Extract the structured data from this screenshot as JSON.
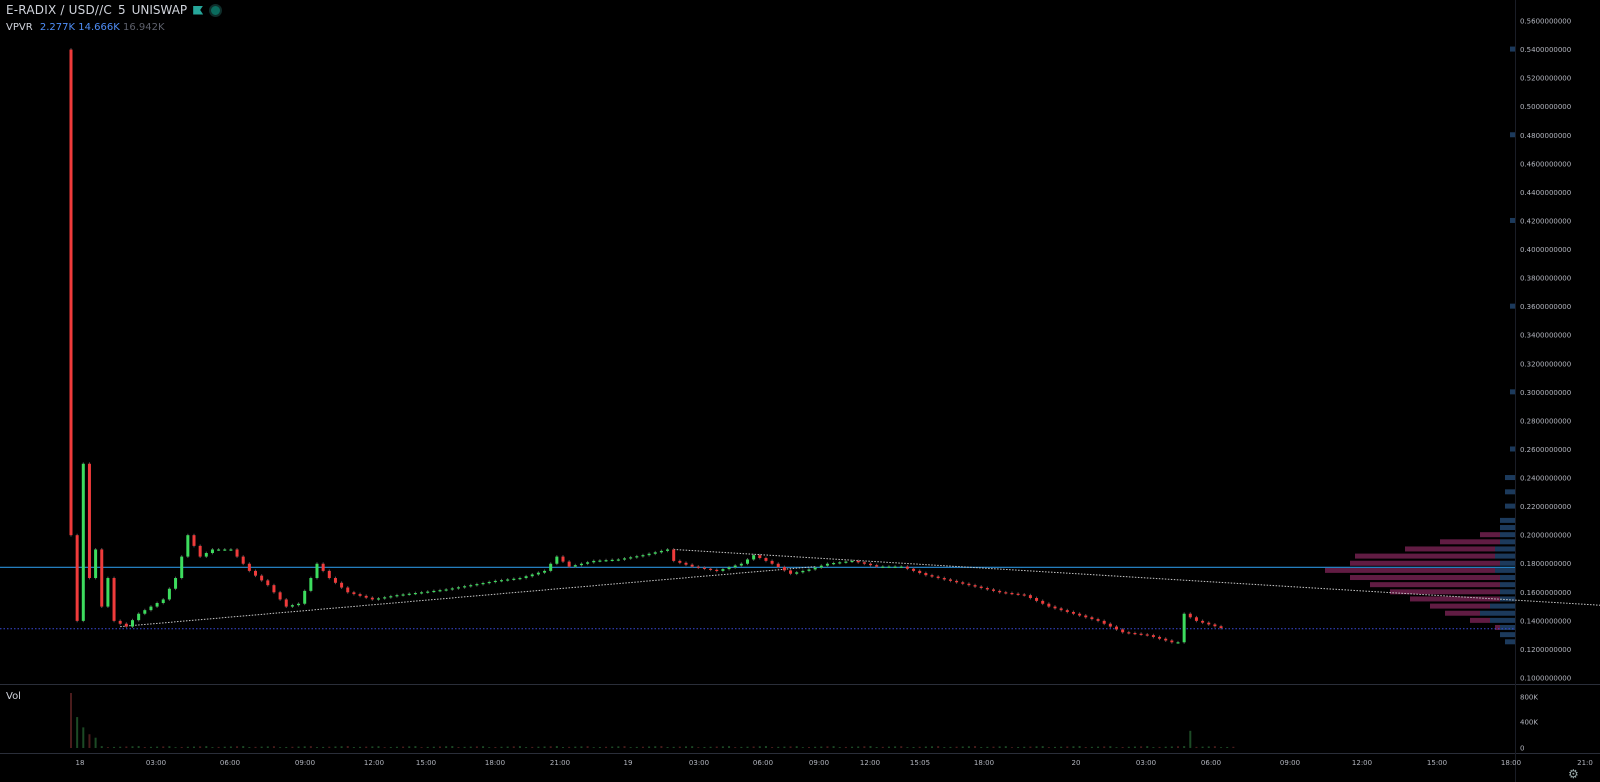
{
  "header": {
    "symbol": "E-RADIX / USD//C",
    "interval": "5",
    "exchange": "UNISWAP"
  },
  "indicator": {
    "name": "VPVR",
    "up_volume": "2.277K",
    "down_volume": "14.666K",
    "total_volume": "16.942K"
  },
  "volume_pane": {
    "label": "Vol",
    "axis_labels": [
      "800K",
      "400K",
      "0"
    ]
  },
  "colors": {
    "background": "#000000",
    "up": "#3ddc5e",
    "down": "#ef3b3b",
    "vp_up": "#1c3a5c",
    "vp_value_area": "#6b1f4a",
    "hline_solid": "#2a8fd8",
    "hline_dotted": "#3a4bd6"
  },
  "chart_data": {
    "type": "candlestick",
    "ylim": [
      0.1,
      0.56
    ],
    "y_tick_labels": [
      "0.5600000000",
      "0.5400000000",
      "0.5200000000",
      "0.5000000000",
      "0.4800000000",
      "0.4600000000",
      "0.4400000000",
      "0.4200000000",
      "0.4000000000",
      "0.3800000000",
      "0.3600000000",
      "0.3400000000",
      "0.3200000000",
      "0.3000000000",
      "0.2800000000",
      "0.2600000000",
      "0.2400000000",
      "0.2200000000",
      "0.2000000000",
      "0.1800000000",
      "0.1600000000",
      "0.1400000000",
      "0.1200000000",
      "0.1000000000"
    ],
    "x_tick_labels": [
      "18",
      "03:00",
      "06:00",
      "09:00",
      "12:00",
      "15:00",
      "18:00",
      "21:00",
      "19",
      "03:00",
      "06:00",
      "09:00",
      "12:00",
      "15:05",
      "18:00",
      "20",
      "03:00",
      "06:00",
      "09:00",
      "12:00",
      "15:00",
      "18:00",
      "21:0"
    ],
    "price_path": [
      [
        0,
        0.54
      ],
      [
        1,
        0.2
      ],
      [
        2,
        0.14
      ],
      [
        3,
        0.25
      ],
      [
        4,
        0.17
      ],
      [
        5,
        0.19
      ],
      [
        6,
        0.15
      ],
      [
        7,
        0.17
      ],
      [
        8,
        0.14
      ],
      [
        10,
        0.136
      ],
      [
        12,
        0.145
      ],
      [
        16,
        0.155
      ],
      [
        18,
        0.17
      ],
      [
        20,
        0.2
      ],
      [
        22,
        0.185
      ],
      [
        24,
        0.19
      ],
      [
        27,
        0.19
      ],
      [
        30,
        0.175
      ],
      [
        33,
        0.165
      ],
      [
        36,
        0.15
      ],
      [
        38,
        0.152
      ],
      [
        40,
        0.17
      ],
      [
        41,
        0.18
      ],
      [
        43,
        0.17
      ],
      [
        46,
        0.16
      ],
      [
        50,
        0.155
      ],
      [
        54,
        0.158
      ],
      [
        58,
        0.16
      ],
      [
        62,
        0.162
      ],
      [
        66,
        0.165
      ],
      [
        70,
        0.168
      ],
      [
        74,
        0.17
      ],
      [
        78,
        0.175
      ],
      [
        80,
        0.185
      ],
      [
        82,
        0.178
      ],
      [
        86,
        0.182
      ],
      [
        90,
        0.183
      ],
      [
        94,
        0.186
      ],
      [
        98,
        0.19
      ],
      [
        99,
        0.182
      ],
      [
        102,
        0.178
      ],
      [
        106,
        0.175
      ],
      [
        110,
        0.18
      ],
      [
        112,
        0.186
      ],
      [
        115,
        0.18
      ],
      [
        118,
        0.173
      ],
      [
        121,
        0.176
      ],
      [
        124,
        0.18
      ],
      [
        128,
        0.182
      ],
      [
        132,
        0.178
      ],
      [
        136,
        0.178
      ],
      [
        140,
        0.172
      ],
      [
        144,
        0.168
      ],
      [
        148,
        0.164
      ],
      [
        152,
        0.16
      ],
      [
        156,
        0.158
      ],
      [
        160,
        0.15
      ],
      [
        164,
        0.145
      ],
      [
        168,
        0.14
      ],
      [
        172,
        0.132
      ],
      [
        176,
        0.13
      ],
      [
        180,
        0.125
      ],
      [
        181,
        0.125
      ],
      [
        182,
        0.145
      ],
      [
        184,
        0.14
      ],
      [
        188,
        0.135
      ]
    ],
    "volume_spikes": [
      [
        0,
        800
      ],
      [
        1,
        450
      ],
      [
        2,
        300
      ],
      [
        3,
        200
      ],
      [
        4,
        150
      ],
      [
        182,
        250
      ]
    ],
    "horizontal_lines": [
      {
        "price": 0.1775,
        "style": "solid"
      },
      {
        "price": 0.1345,
        "style": "dotted"
      }
    ],
    "trend_lines": [
      {
        "from": [
          8,
          0.136
        ],
        "to": [
          121,
          0.178
        ]
      },
      {
        "from": [
          98,
          0.19
        ],
        "to": [
          260,
          0.148
        ]
      }
    ],
    "volume_profile": [
      {
        "price": 0.125,
        "up": 2,
        "down": 0
      },
      {
        "price": 0.13,
        "up": 3,
        "down": 0
      },
      {
        "price": 0.135,
        "up": 3,
        "down": 1
      },
      {
        "price": 0.14,
        "up": 5,
        "down": 4
      },
      {
        "price": 0.145,
        "up": 7,
        "down": 7
      },
      {
        "price": 0.15,
        "up": 5,
        "down": 12
      },
      {
        "price": 0.155,
        "up": 3,
        "down": 18
      },
      {
        "price": 0.16,
        "up": 3,
        "down": 22
      },
      {
        "price": 0.165,
        "up": 3,
        "down": 26
      },
      {
        "price": 0.17,
        "up": 3,
        "down": 30
      },
      {
        "price": 0.175,
        "up": 4,
        "down": 34
      },
      {
        "price": 0.18,
        "up": 3,
        "down": 30
      },
      {
        "price": 0.185,
        "up": 4,
        "down": 28
      },
      {
        "price": 0.19,
        "up": 4,
        "down": 18
      },
      {
        "price": 0.195,
        "up": 3,
        "down": 12
      },
      {
        "price": 0.2,
        "up": 3,
        "down": 4
      },
      {
        "price": 0.205,
        "up": 3,
        "down": 0
      },
      {
        "price": 0.21,
        "up": 3,
        "down": 0
      },
      {
        "price": 0.22,
        "up": 2,
        "down": 0
      },
      {
        "price": 0.23,
        "up": 2,
        "down": 0
      },
      {
        "price": 0.24,
        "up": 2,
        "down": 0
      },
      {
        "price": 0.26,
        "up": 1,
        "down": 0
      },
      {
        "price": 0.3,
        "up": 1,
        "down": 0
      },
      {
        "price": 0.36,
        "up": 1,
        "down": 0
      },
      {
        "price": 0.42,
        "up": 1,
        "down": 0
      },
      {
        "price": 0.48,
        "up": 1,
        "down": 0
      },
      {
        "price": 0.54,
        "up": 1,
        "down": 0
      }
    ]
  }
}
